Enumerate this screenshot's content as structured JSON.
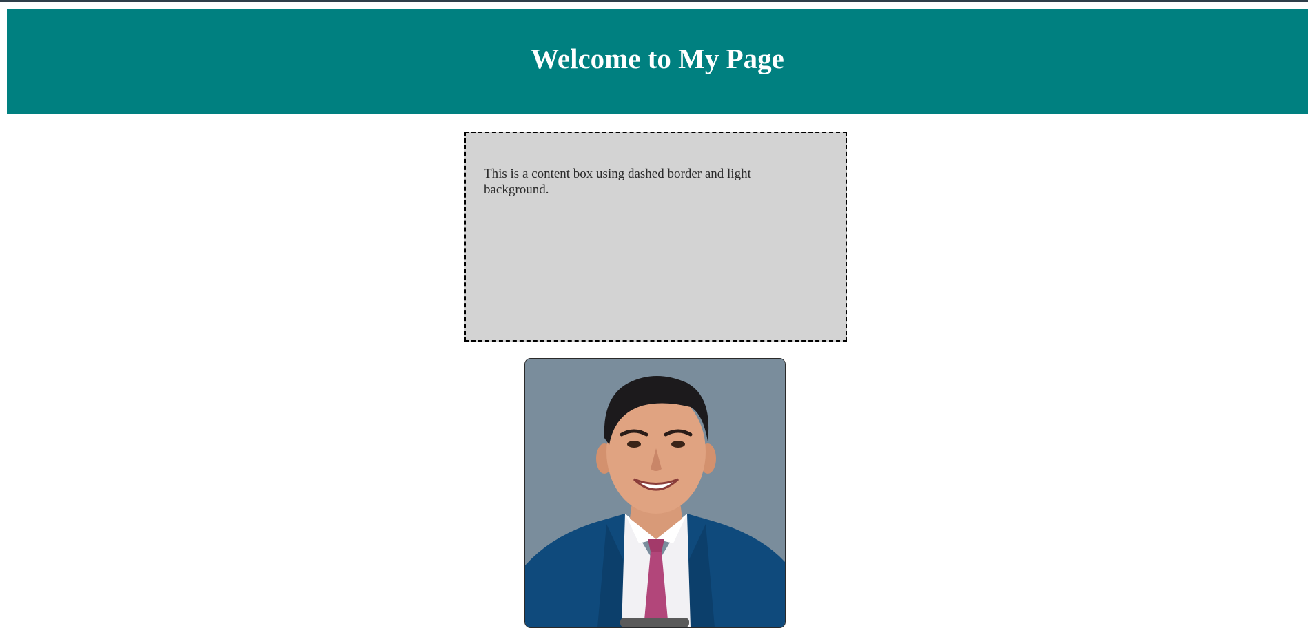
{
  "header": {
    "title": "Welcome to My Page",
    "background_color": "#008080"
  },
  "content_box": {
    "text": "This is a content box using dashed border and light background.",
    "background_color": "#d3d3d3"
  },
  "profile_photo": {
    "subject": "smiling man in blue suit and pink tie",
    "background_color": "#7a8d9c"
  }
}
